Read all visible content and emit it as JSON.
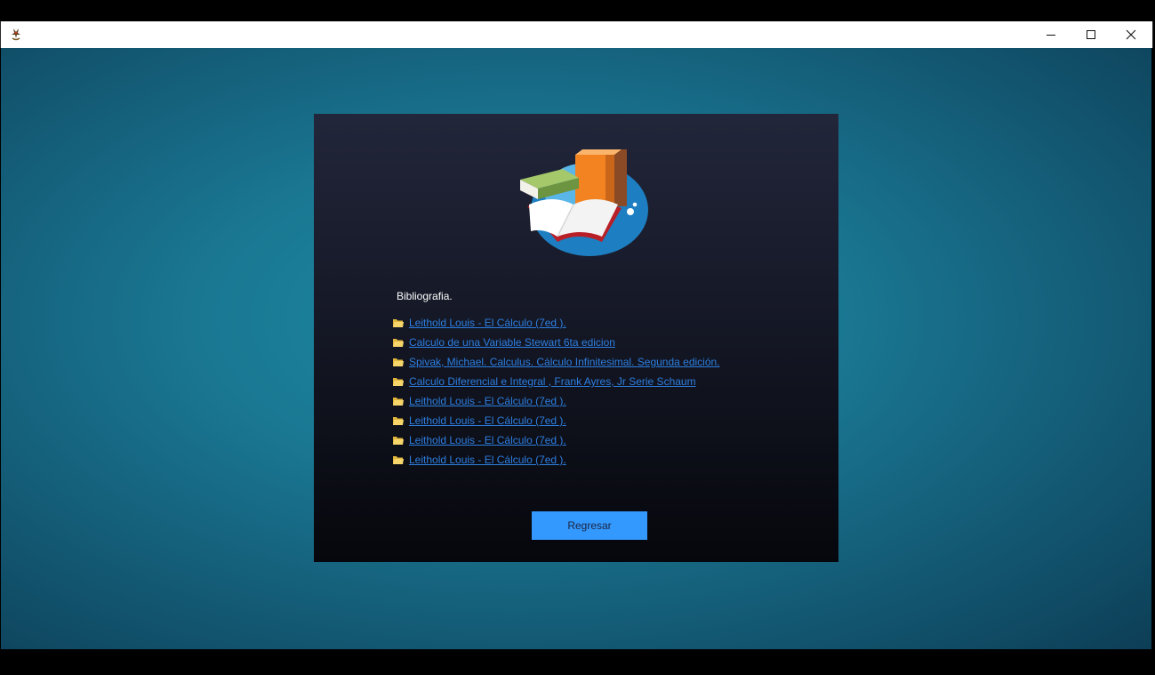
{
  "window": {
    "title": "",
    "controls": [
      "minimize-icon",
      "maximize-icon",
      "close-icon"
    ]
  },
  "panel": {
    "section_title": "Bibliografia.",
    "references": [
      "Leithold Louis - El Cálculo (7ed ).",
      "Calculo de una Variable Stewart 6ta edicion",
      "Spivak, Michael. Calculus. Cálculo Infinitesimal. Segunda edición.",
      "Calculo Diferencial e Integral , Frank Ayres, Jr Serie Schaum",
      "Leithold Louis - El Cálculo (7ed ).",
      "Leithold Louis - El Cálculo (7ed ).",
      "Leithold Louis - El Cálculo (7ed ).",
      "Leithold Louis - El Cálculo (7ed )."
    ],
    "back_label": "Regresar"
  },
  "colors": {
    "background": "#1a7893",
    "panel": "#151826",
    "link": "#2d7ee0",
    "button": "#3399ff"
  }
}
